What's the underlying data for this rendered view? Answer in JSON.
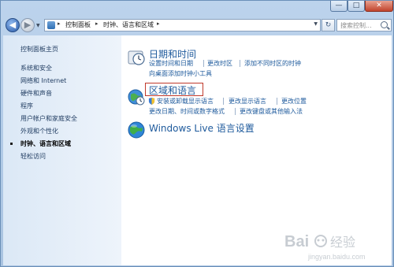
{
  "window": {
    "min_glyph": "—",
    "max_glyph": "□",
    "close_glyph": "✕"
  },
  "navigation": {
    "back_glyph": "◀",
    "forward_glyph": "▶",
    "breadcrumb": [
      "控制面板",
      "时钟、语言和区域"
    ],
    "separator": "▸",
    "refresh_glyph": "↻",
    "search_placeholder": "搜索控制..."
  },
  "sidebar": {
    "items": [
      {
        "label": "控制面板主页"
      },
      {
        "label": "系统和安全"
      },
      {
        "label": "网络和 Internet"
      },
      {
        "label": "硬件和声音"
      },
      {
        "label": "程序"
      },
      {
        "label": "用户帐户和家庭安全"
      },
      {
        "label": "外观和个性化"
      },
      {
        "label": "时钟、语言和区域",
        "active": true
      },
      {
        "label": "轻松访问"
      }
    ]
  },
  "categories": [
    {
      "icon": "clock-icon",
      "title": "日期和时间",
      "links": [
        "设置时间和日期",
        "更改时区",
        "添加不同时区的时钟",
        "向桌面添加时钟小工具"
      ]
    },
    {
      "icon": "globe-clock-icon",
      "title": "区域和语言",
      "links": [
        "安装或卸载显示语言",
        "更改显示语言",
        "更改位置",
        "更改日期、时间或数字格式",
        "更改键盘或其他输入法"
      ]
    },
    {
      "icon": "globe-icon",
      "title": "Windows Live 语言设置",
      "links": []
    }
  ],
  "colors": {
    "link": "#1e5a9c",
    "highlight_box": "#c0392b",
    "sidebar": "#dbe8f6"
  },
  "watermark": {
    "text": "Bai 经验",
    "url": "jingyan.baidu.com"
  }
}
